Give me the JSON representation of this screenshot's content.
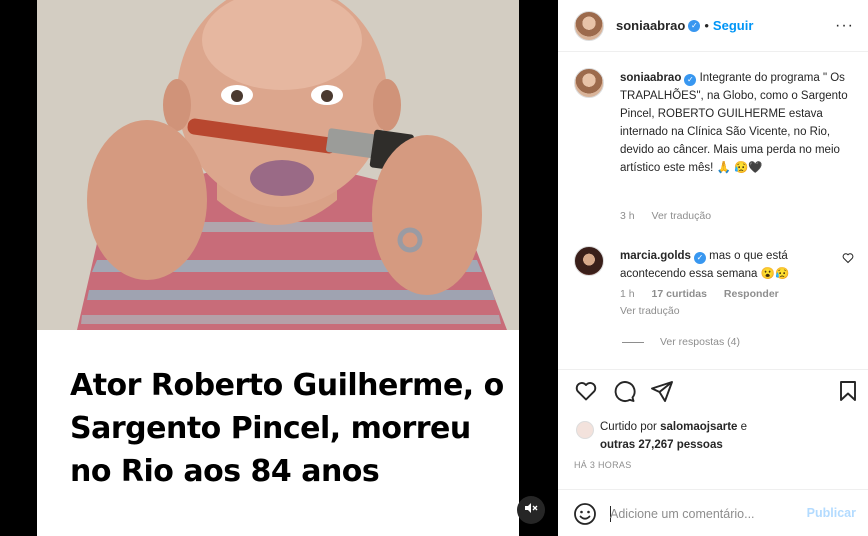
{
  "post": {
    "headline": "Ator Roberto Guilherme, o Sargento Pincel, morreu no Rio aos 84 anos"
  },
  "header": {
    "username": "soniaabrao",
    "dot": "•",
    "follow_label": "Seguir",
    "more_label": "···"
  },
  "caption": {
    "username": "soniaabrao",
    "text": "Integrante do programa \" Os TRAPALHÕES\", na Globo, como o Sargento Pincel, ROBERTO GUILHERME estava internado na Clínica São Vicente, no Rio, devido ao câncer. Mais uma perda no meio artístico este mês! 🙏 😥🖤",
    "time": "3 h",
    "translate": "Ver tradução"
  },
  "comment": {
    "username": "marcia.golds",
    "text": "mas o que está acontecendo essa semana 😮😥",
    "time": "1 h",
    "likes": "17 curtidas",
    "reply": "Responder",
    "translate": "Ver tradução",
    "view_replies": "Ver respostas (4)"
  },
  "likes": {
    "prefix": "Curtido por",
    "user": "salomaojsarte",
    "suffix": "e",
    "others": "outras 27,267 pessoas"
  },
  "timestamp": "HÁ 3 HORAS",
  "comment_box": {
    "placeholder": "Adicione um comentário...",
    "publish_label": "Publicar"
  },
  "icons": {
    "like": "heart-icon",
    "comment": "comment-icon",
    "share": "share-icon",
    "save": "bookmark-icon",
    "emoji": "emoji-icon",
    "mute": "speaker-muted-icon"
  },
  "colors": {
    "accent": "#0095f6",
    "verified": "#3897f0",
    "muted_text": "#8e8e8e",
    "publish_disabled": "#b3dbff"
  }
}
